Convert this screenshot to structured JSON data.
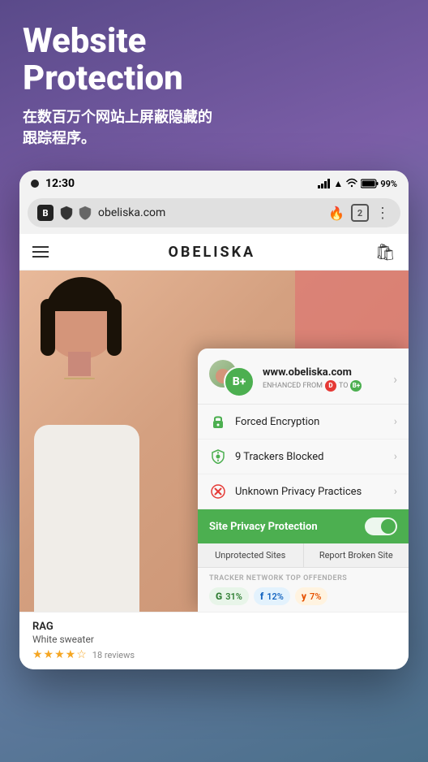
{
  "hero": {
    "title": "Website\nProtection",
    "subtitle": "在数百万个网站上屏蔽隐藏的\n跟踪程序。"
  },
  "status_bar": {
    "time": "12:30",
    "battery": "99%"
  },
  "url_bar": {
    "url": "obeliska.com",
    "tab_count": "2"
  },
  "site_header": {
    "logo": "OBELISKA"
  },
  "privacy_panel": {
    "site_url": "www.obeliska.com",
    "enhanced_from": "ENHANCED FROM",
    "grade_from": "D",
    "grade_to": "B+",
    "grade_display": "B+",
    "items": [
      {
        "label": "Forced Encryption",
        "icon": "lock"
      },
      {
        "label": "9 Trackers Blocked",
        "icon": "shield"
      },
      {
        "label": "Unknown Privacy Practices",
        "icon": "x"
      }
    ],
    "toggle_label": "Site Privacy Protection",
    "tabs": [
      "Unprotected Sites",
      "Report Broken Site"
    ],
    "tracker_section_title": "TRACKER NETWORK TOP OFFENDERS",
    "trackers": [
      {
        "letter": "G",
        "percent": "31%",
        "style": "g"
      },
      {
        "letter": "f",
        "percent": "12%",
        "style": "f"
      },
      {
        "letter": "y",
        "percent": "7%",
        "style": "y"
      }
    ]
  },
  "product": {
    "name": "RAG",
    "description": "White sweater",
    "reviews": "18 reviews"
  }
}
